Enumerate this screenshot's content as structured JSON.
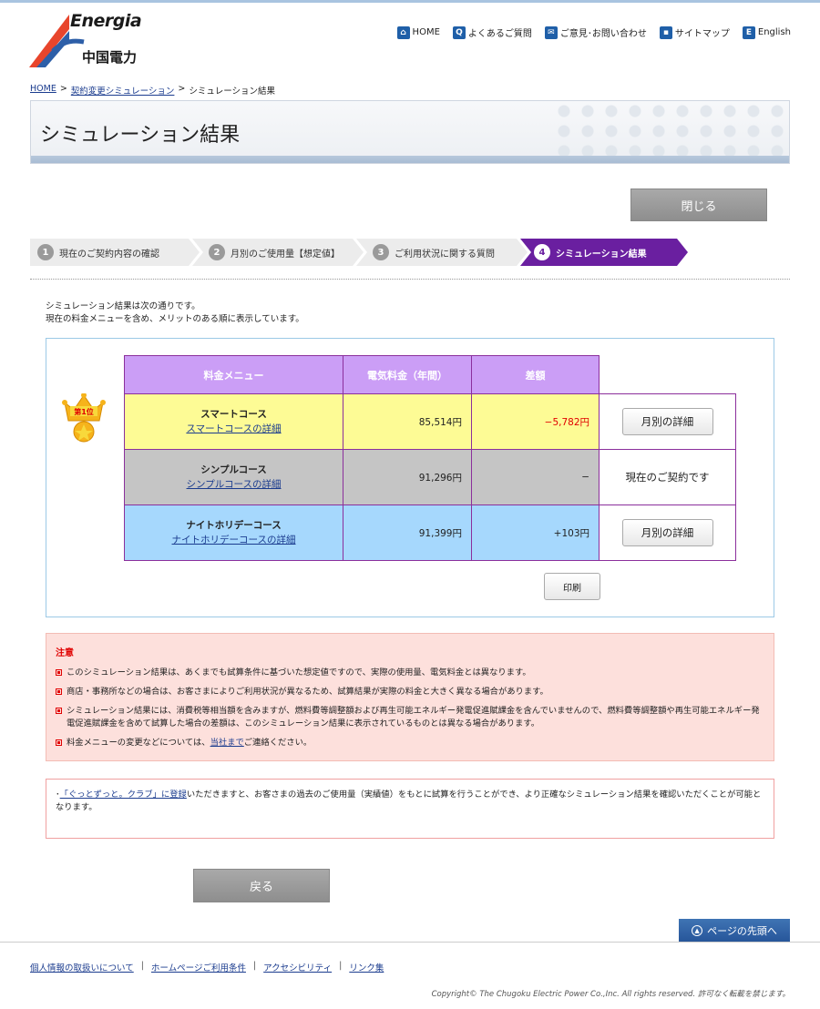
{
  "header": {
    "logo_en": "Energia",
    "logo_jp": "中国電力",
    "nav": [
      {
        "icon": "home-icon",
        "glyph": "⌂",
        "label": "HOME"
      },
      {
        "icon": "faq-icon",
        "glyph": "Q",
        "label": "よくあるご質問"
      },
      {
        "icon": "mail-icon",
        "glyph": "✉",
        "label": "ご意見･お問い合わせ"
      },
      {
        "icon": "sitemap-icon",
        "glyph": "▪",
        "label": "サイトマップ"
      },
      {
        "icon": "english-icon",
        "glyph": "E",
        "label": "English"
      }
    ]
  },
  "breadcrumb": {
    "home": "HOME",
    "sep": ">",
    "sim": "契約変更シミュレーション",
    "current": "シミュレーション結果"
  },
  "page_title": "シミュレーション結果",
  "close_label": "閉じる",
  "steps": [
    {
      "num": "1",
      "label": "現在のご契約内容の確認"
    },
    {
      "num": "2",
      "label": "月別のご使用量【想定値】"
    },
    {
      "num": "3",
      "label": "ご利用状況に関する質問"
    },
    {
      "num": "4",
      "label": "シミュレーション結果"
    }
  ],
  "intro": {
    "line1": "シミュレーション結果は次の通りです。",
    "line2": "現在の料金メニューを含め、メリットのある順に表示しています。"
  },
  "results": {
    "headers": {
      "menu": "料金メニュー",
      "fee": "電気料金（年間）",
      "diff": "差額"
    },
    "rank_badge": "第1位",
    "rows": [
      {
        "name": "スマートコース",
        "link": "スマートコースの詳細",
        "fee": "85,514円",
        "diff": "−5,782円",
        "action": "月別の詳細"
      },
      {
        "name": "シンプルコース",
        "link": "シンプルコースの詳細",
        "fee": "91,296円",
        "diff": "−",
        "action": "現在のご契約です"
      },
      {
        "name": "ナイトホリデーコース",
        "link": "ナイトホリデーコースの詳細",
        "fee": "91,399円",
        "diff": "+103円",
        "action": "月別の詳細"
      }
    ],
    "print_label": "印刷"
  },
  "notice": {
    "title": "注意",
    "items": [
      "このシミュレーション結果は、あくまでも試算条件に基づいた想定値ですので、実際の使用量、電気料金とは異なります。",
      "商店・事務所などの場合は、お客さまによりご利用状況が異なるため、試算結果が実際の料金と大きく異なる場合があります。",
      "シミュレーション結果には、消費税等相当額を含みますが、燃料費等調整額および再生可能エネルギー発電促進賦課金を含んでいませんので、燃料費等調整額や再生可能エネルギー発電促進賦課金を含めて試算した場合の差額は、このシミュレーション結果に表示されているものとは異なる場合があります。"
    ],
    "last_pre": "料金メニューの変更などについては、",
    "last_link": "当社まで",
    "last_post": "ご連絡ください。"
  },
  "club": {
    "pre": "･",
    "link": "「ぐっとずっと。クラブ」に登録",
    "post": "いただきますと、お客さまの過去のご使用量（実績値）をもとに試算を行うことができ、より正確なシミュレーション結果を確認いただくことが可能となります。"
  },
  "back_label": "戻る",
  "pagetop_label": "ページの先頭へ",
  "footer": {
    "links": [
      "個人情報の取扱いについて",
      "ホームページご利用条件",
      "アクセシビリティ",
      "リンク集"
    ],
    "sep": "|",
    "copyright": "Copyright© The Chugoku Electric Power Co.,Inc. All rights reserved.  許可なく転載を禁じます。"
  },
  "colors": {
    "step_active": "#6a1fa0",
    "header_purple": "#cb9ef6",
    "row_best": "#fdfb95",
    "row_current": "#c5c5c5",
    "row_other": "#a6d8fd",
    "negative": "#e00000"
  }
}
